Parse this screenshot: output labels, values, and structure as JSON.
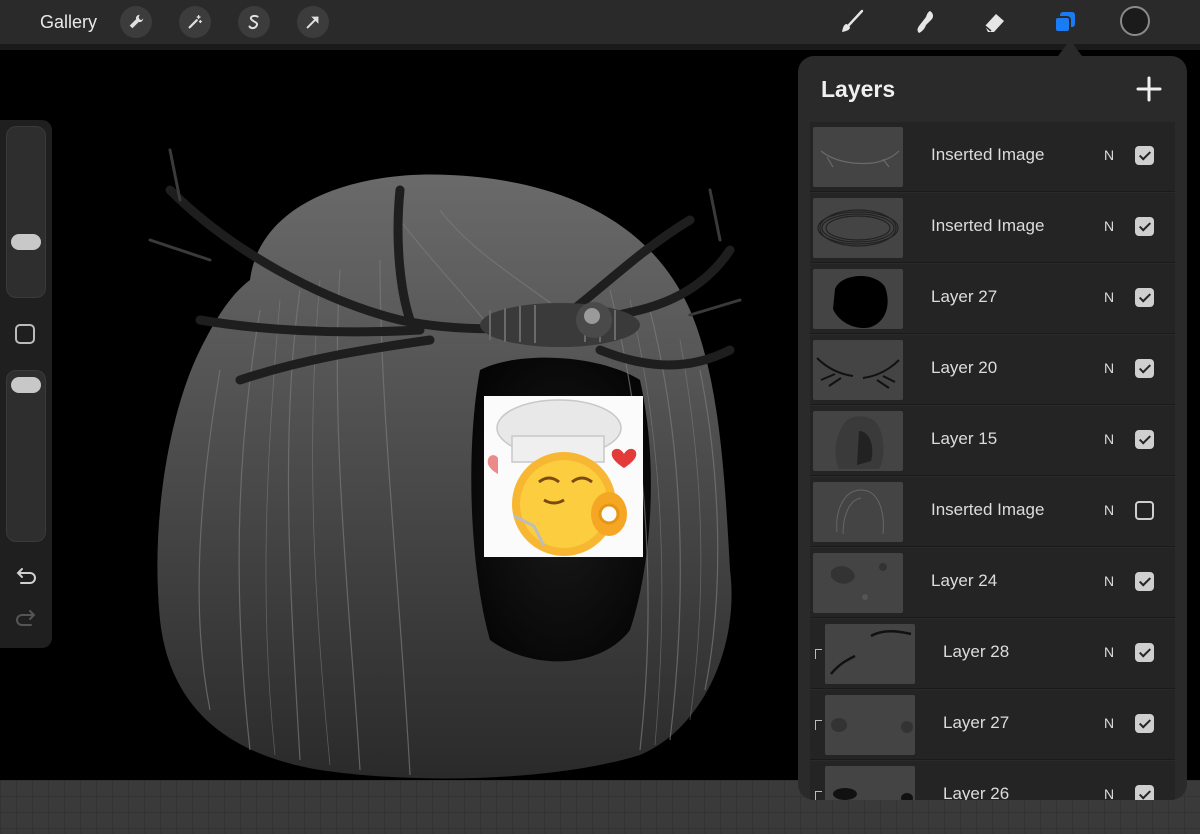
{
  "toolbar": {
    "gallery_label": "Gallery",
    "left_tools": [
      "wrench-icon",
      "magic-wand-icon",
      "selection-icon",
      "transform-arrow-icon"
    ],
    "right_tools": [
      "brush-icon",
      "smudge-icon",
      "eraser-icon",
      "layers-icon"
    ],
    "active_tool": "layers-icon",
    "active_color": "#1b1b1b",
    "accent": "#1a7cf5"
  },
  "sidebar": {
    "controls": [
      "brush-size-slider",
      "modify-button",
      "opacity-slider",
      "undo-icon",
      "redo-icon"
    ]
  },
  "layers_panel": {
    "title": "Layers",
    "add_icon": "plus-icon",
    "layers": [
      {
        "name": "Inserted Image",
        "blend": "N",
        "visible": true,
        "clipped": false
      },
      {
        "name": "Inserted Image",
        "blend": "N",
        "visible": true,
        "clipped": false
      },
      {
        "name": "Layer 27",
        "blend": "N",
        "visible": true,
        "clipped": false
      },
      {
        "name": "Layer 20",
        "blend": "N",
        "visible": true,
        "clipped": false
      },
      {
        "name": "Layer 15",
        "blend": "N",
        "visible": true,
        "clipped": false
      },
      {
        "name": "Inserted Image",
        "blend": "N",
        "visible": false,
        "clipped": false
      },
      {
        "name": "Layer 24",
        "blend": "N",
        "visible": true,
        "clipped": false
      },
      {
        "name": "Layer 28",
        "blend": "N",
        "visible": true,
        "clipped": true
      },
      {
        "name": "Layer 27",
        "blend": "N",
        "visible": true,
        "clipped": true
      },
      {
        "name": "Layer 26",
        "blend": "N",
        "visible": true,
        "clipped": true
      }
    ]
  }
}
